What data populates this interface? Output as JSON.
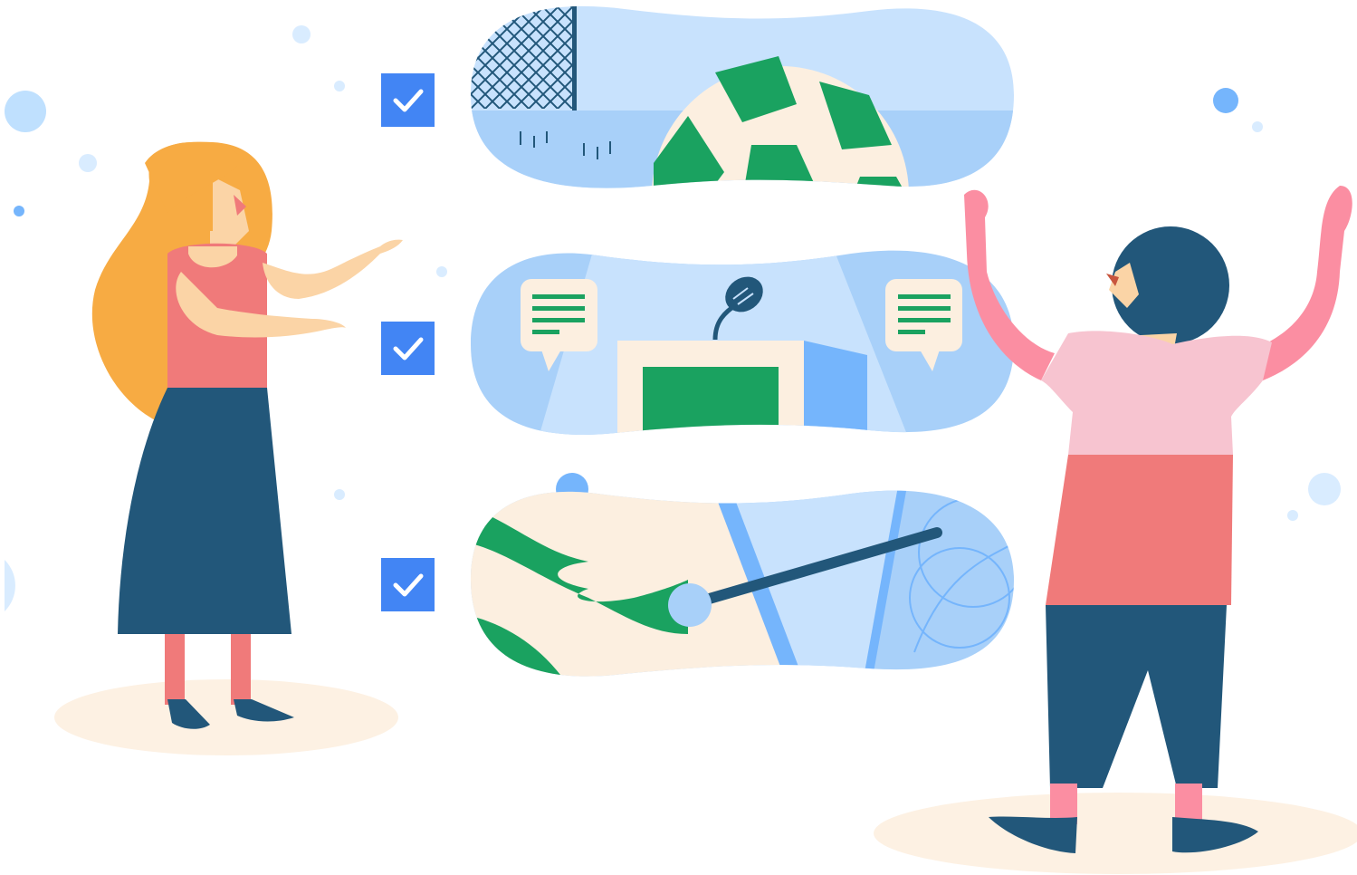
{
  "scene": {
    "subject": "illustration",
    "checkboxes": [
      {
        "name": "checkbox-soccer",
        "checked": true
      },
      {
        "name": "checkbox-podium",
        "checked": true
      },
      {
        "name": "checkbox-pointer",
        "checked": true
      }
    ],
    "colors": {
      "checkbox": "#4285f4",
      "check": "#ffffff",
      "panel": "#c8e2fd",
      "panel_light": "#d9ecff",
      "field": "#a8d0f9",
      "green": "#1aa260",
      "cream": "#fcefe0",
      "navy": "#22577a",
      "pink_shirt": "#f7c4d0",
      "coral": "#f07a7a",
      "skin": "#fbd4a6",
      "hair": "#f7ab43",
      "ground": "#fdf1e3",
      "accent_blue": "#75b5fc",
      "dot": "#a9d2fd"
    }
  }
}
